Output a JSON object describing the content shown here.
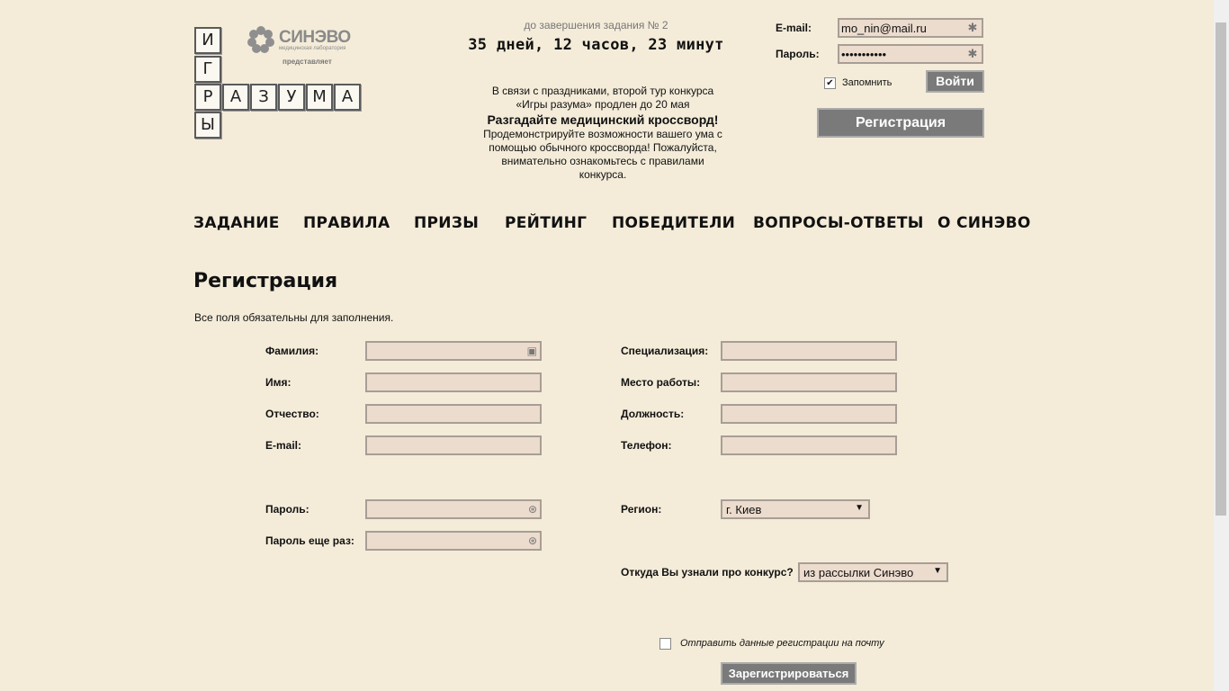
{
  "logo": {
    "letters_vertical": [
      "И",
      "Г",
      "Р",
      "Ы"
    ],
    "letters_horizontal": [
      "А",
      "З",
      "У",
      "М",
      "А"
    ],
    "sponsor_name": "СИНЭВО",
    "sponsor_subtitle": "медицинская лаборатория",
    "sponsor_presents": "представляет"
  },
  "countdown": {
    "caption": "до завершения задания № 2",
    "value": "35 дней, 12 часов, 23 минут"
  },
  "news": {
    "line1": "В связи с праздниками, второй тур конкурса «Игры разума» продлен до 20 мая",
    "headline": "Разгадайте медицинский кроссворд!",
    "body": "Продемонстрируйте возможности вашего ума с помощью обычного кроссворда! Пожалуйста, внимательно ознакомьтесь с правилами конкурса."
  },
  "login": {
    "email_label": "E-mail:",
    "email_value": "mo_nin@mail.ru",
    "password_label": "Пароль:",
    "password_value": "•••••••••••",
    "remember_label": "Запомнить",
    "remember_checked": true,
    "login_button": "Войти",
    "register_button": "Регистрация"
  },
  "nav": {
    "items": [
      "ЗАДАНИЕ",
      "ПРАВИЛА",
      "ПРИЗЫ",
      "РЕЙТИНГ",
      "ПОБЕДИТЕЛИ",
      "ВОПРОСЫ-ОТВЕТЫ",
      "О СИНЭВО"
    ]
  },
  "form": {
    "title": "Регистрация",
    "note": "Все поля обязательны для заполнения.",
    "left_fields": [
      "Фамилия:",
      "Имя:",
      "Отчество:",
      "E-mail:"
    ],
    "right_fields": [
      "Специализация:",
      "Место работы:",
      "Должность:",
      "Телефон:"
    ],
    "password_label": "Пароль:",
    "password_repeat_label": "Пароль еще раз:",
    "region_label": "Регион:",
    "region_value": "г. Киев",
    "source_label": "Откуда Вы узнали про конкурс?",
    "source_value": "из рассылки Синэво",
    "send_copy_label": "Отправить данные регистрации на почту",
    "send_copy_checked": false,
    "submit_button": "Зарегистрироваться"
  },
  "colors": {
    "background": "#f4ecd9",
    "input_bg": "#ecdcce",
    "button_grey": "#7a7a7a"
  }
}
